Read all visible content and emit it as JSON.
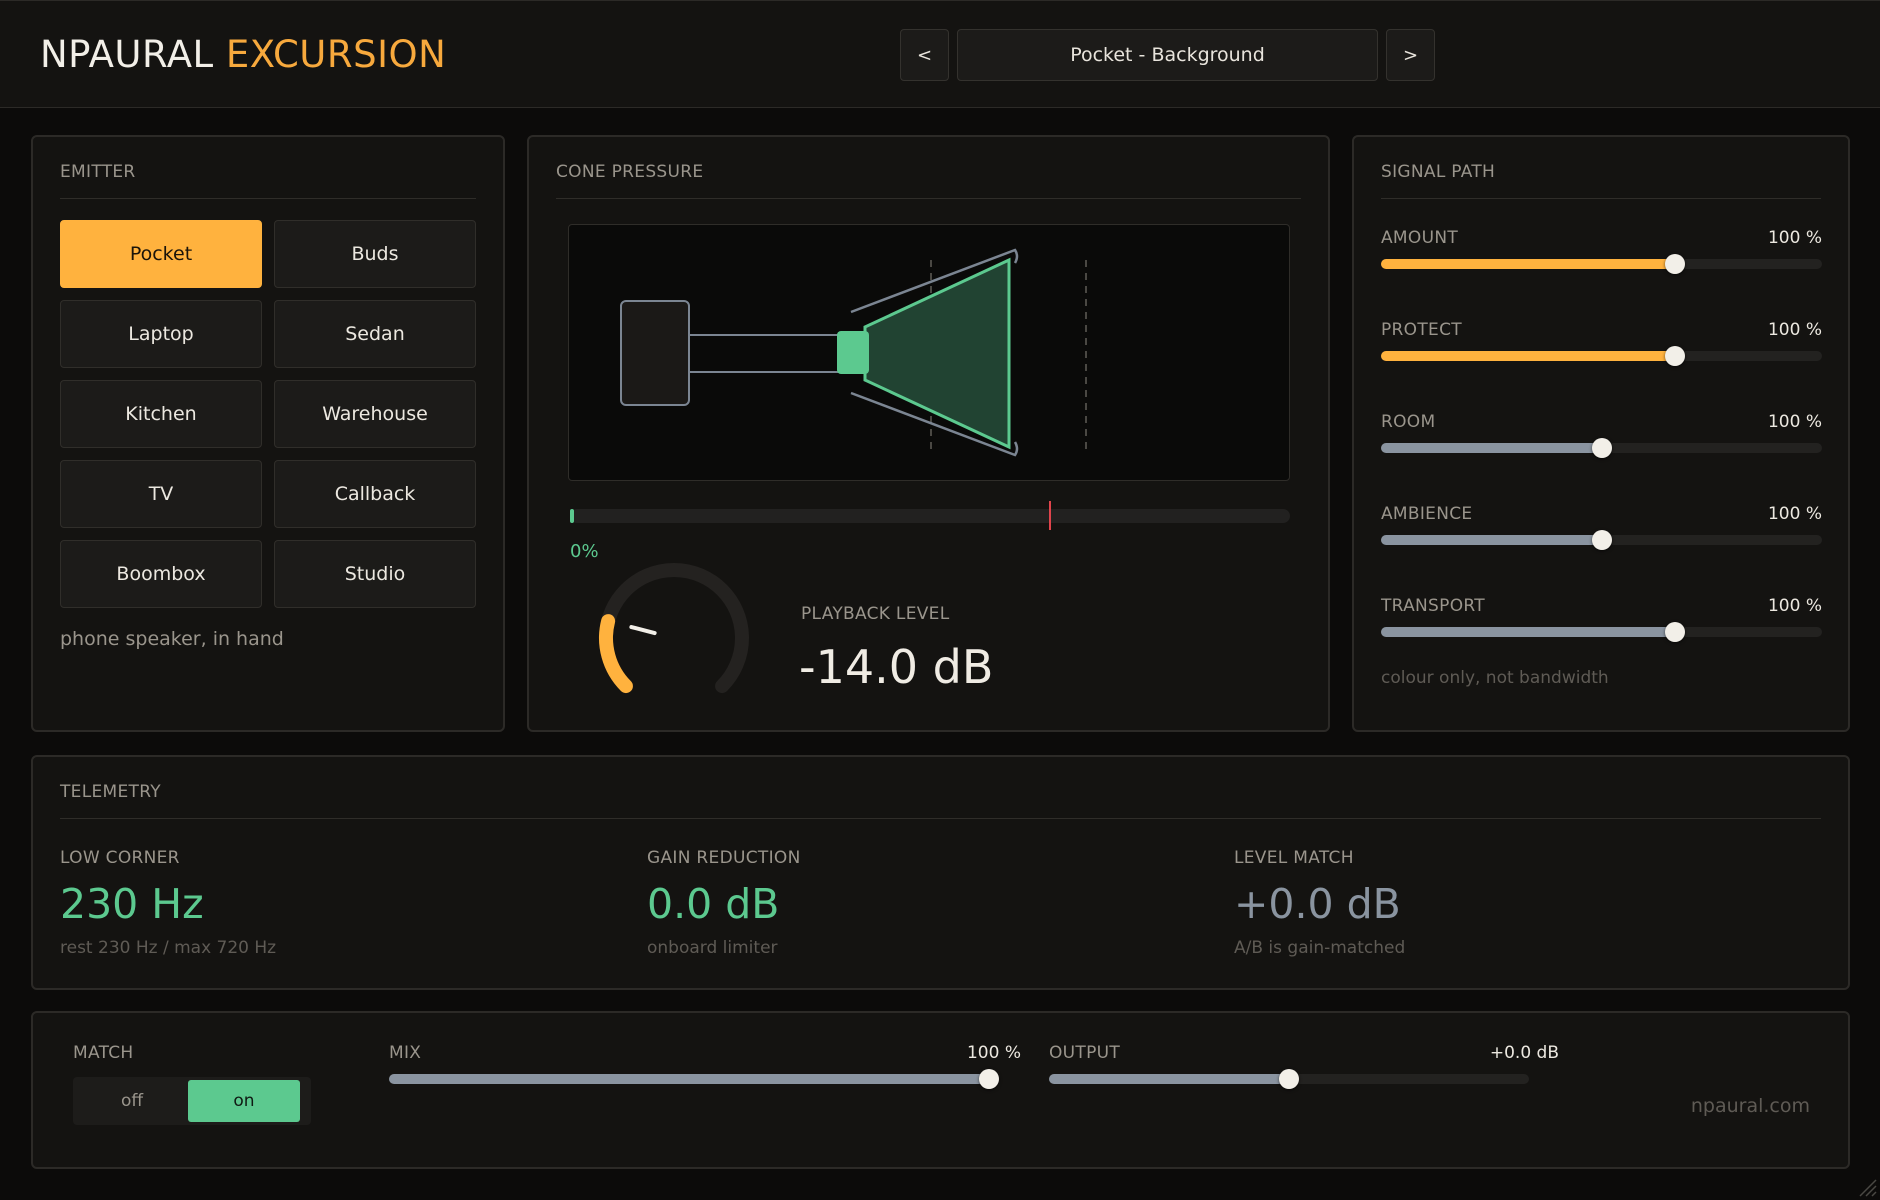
{
  "header": {
    "brand": "NPAURAL",
    "product": "EXCURSION",
    "prev_label": "<",
    "next_label": ">",
    "preset_name": "Pocket - Background"
  },
  "emitter": {
    "title": "EMITTER",
    "buttons": [
      "Pocket",
      "Buds",
      "Laptop",
      "Sedan",
      "Kitchen",
      "Warehouse",
      "TV",
      "Callback",
      "Boombox",
      "Studio"
    ],
    "active": "Pocket",
    "description": "phone speaker, in hand"
  },
  "cone": {
    "title": "CONE PRESSURE",
    "meter_value": "0%",
    "meter_fraction": 0.0,
    "marker_fraction": 0.665,
    "playback_label": "PLAYBACK LEVEL",
    "playback_value": "-14.0 dB",
    "knob_fraction": 0.22
  },
  "signal": {
    "title": "SIGNAL PATH",
    "sliders": [
      {
        "label": "AMOUNT",
        "value": "100 %",
        "fraction": 0.667,
        "color": "#ffb23e"
      },
      {
        "label": "PROTECT",
        "value": "100 %",
        "fraction": 0.667,
        "color": "#ffb23e"
      },
      {
        "label": "ROOM",
        "value": "100 %",
        "fraction": 0.5,
        "color": "#8a94a0"
      },
      {
        "label": "AMBIENCE",
        "value": "100 %",
        "fraction": 0.5,
        "color": "#8a94a0"
      },
      {
        "label": "TRANSPORT",
        "value": "100 %",
        "fraction": 0.667,
        "color": "#8a94a0"
      }
    ],
    "note": "colour only, not bandwidth"
  },
  "telemetry": {
    "title": "TELEMETRY",
    "low_corner": {
      "label": "LOW CORNER",
      "value": "230 Hz",
      "sub": "rest 230 Hz / max 720 Hz",
      "color": "#5cc98f"
    },
    "gain_reduction": {
      "label": "GAIN REDUCTION",
      "value": "0.0 dB",
      "sub": "onboard limiter",
      "color": "#5cc98f"
    },
    "level_match": {
      "label": "LEVEL MATCH",
      "value": "+0.0 dB",
      "sub": "A/B is gain-matched",
      "color": "#8a94a0"
    }
  },
  "bottom": {
    "match_label": "MATCH",
    "off_label": "off",
    "on_label": "on",
    "match_state": "on",
    "mix_label": "MIX",
    "mix_value": "100 %",
    "mix_fraction": 1.0,
    "output_label": "OUTPUT",
    "output_value": "+0.0 dB",
    "output_fraction": 0.5,
    "site": "npaural.com"
  },
  "colors": {
    "accent": "#ffb23e",
    "green": "#5cc98f",
    "steel": "#8a94a0",
    "marker": "#e0444c"
  }
}
